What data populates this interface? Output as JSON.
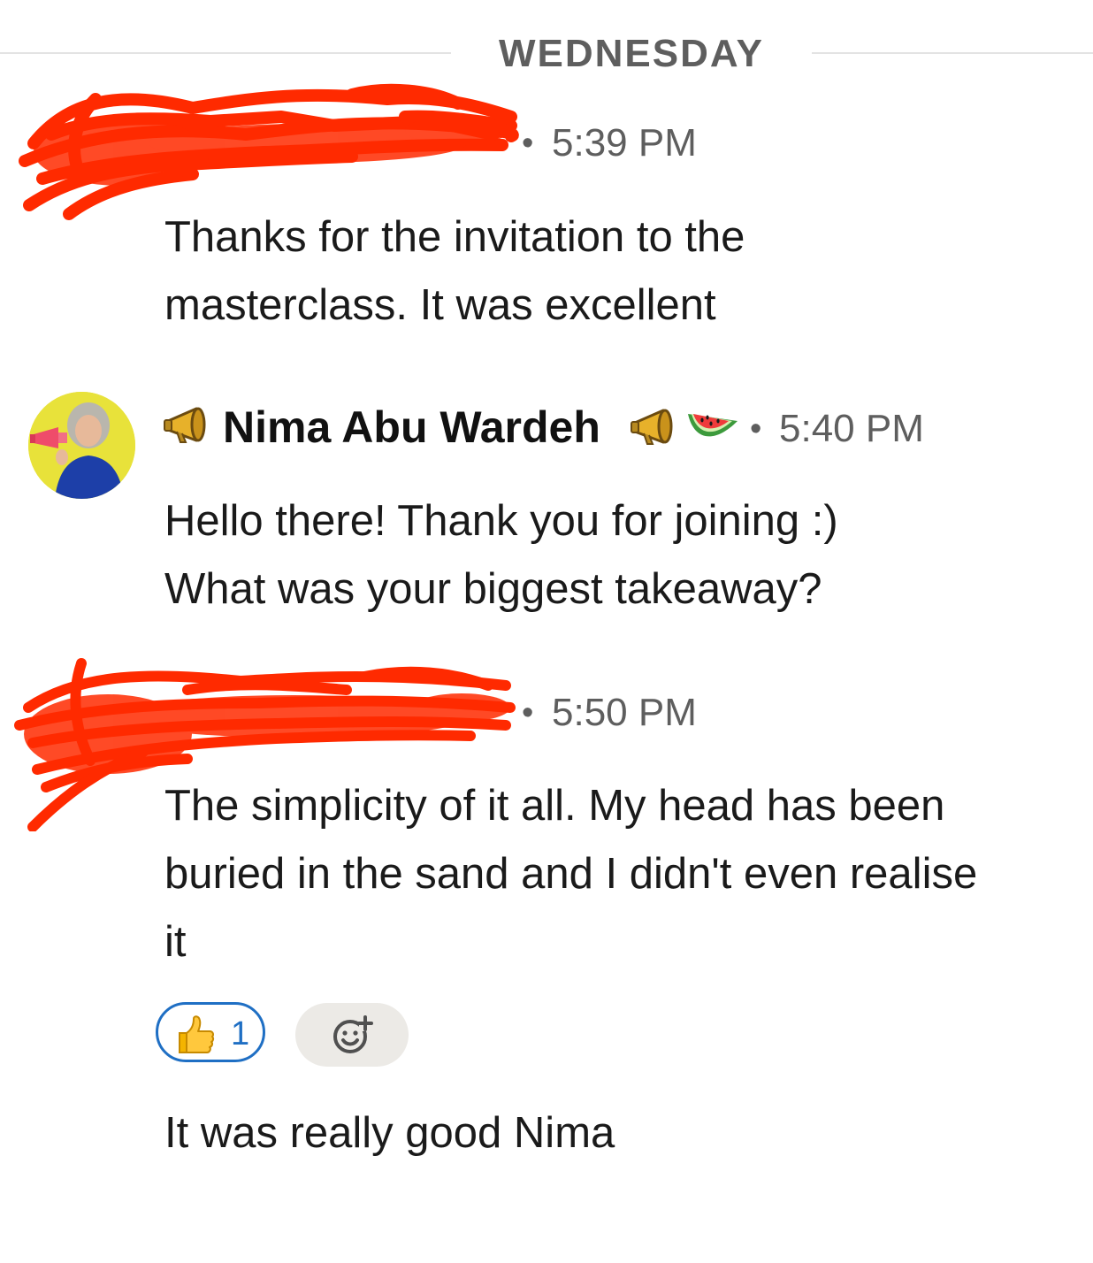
{
  "day_divider": {
    "label": "WEDNESDAY"
  },
  "messages": [
    {
      "sender_name": "",
      "time": "5:39 PM",
      "text_lines": [
        "Thanks for the invitation to the",
        "masterclass. It was excellent"
      ]
    },
    {
      "sender_name": "Nima Abu Wardeh",
      "time": "5:40 PM",
      "text_lines": [
        "Hello there! Thank you for joining :)",
        "What was your biggest takeaway?"
      ],
      "name_icons": [
        "megaphone-icon",
        "megaphone-icon",
        "watermelon-icon"
      ]
    },
    {
      "sender_name": "",
      "time": "5:50 PM",
      "text_lines": [
        "The simplicity of it all. My head has been",
        "buried in the sand and I didn't even realise",
        "it"
      ],
      "reactions": [
        {
          "icon": "thumbs-up-icon",
          "count": "1"
        }
      ],
      "add_reaction_icon": "add-reaction-icon"
    },
    {
      "sender_name": "",
      "time": "",
      "text_lines": [
        "It was really good Nima"
      ]
    }
  ],
  "separator": "•",
  "colors": {
    "redaction": "#ff2a00",
    "reaction_border": "#1f6fc4",
    "timestamp": "#5e5e5e",
    "divider": "#e3e3e3"
  }
}
